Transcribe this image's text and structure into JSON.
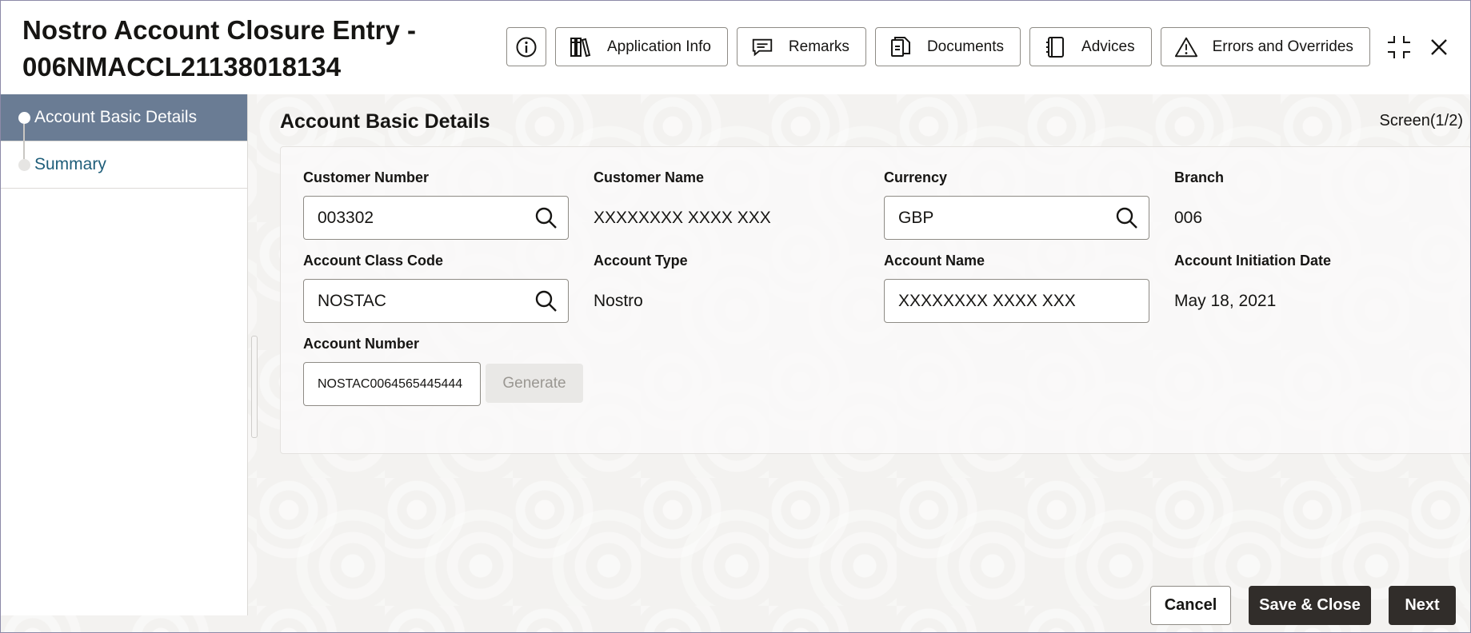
{
  "header": {
    "title_line1": "Nostro Account Closure Entry -",
    "title_line2": "006NMACCL21138018134",
    "toolbar": {
      "application_info": "Application Info",
      "remarks": "Remarks",
      "documents": "Documents",
      "advices": "Advices",
      "errors_overrides": "Errors and Overrides"
    }
  },
  "sidebar": {
    "items": [
      {
        "label": "Account Basic Details",
        "active": true
      },
      {
        "label": "Summary",
        "active": false
      }
    ]
  },
  "content": {
    "title": "Account Basic Details",
    "screen_indicator": "Screen(1/2)",
    "fields": {
      "customer_number": {
        "label": "Customer Number",
        "value": "003302"
      },
      "customer_name": {
        "label": "Customer Name",
        "value": "XXXXXXXX XXXX XXX"
      },
      "currency": {
        "label": "Currency",
        "value": "GBP"
      },
      "branch": {
        "label": "Branch",
        "value": "006"
      },
      "account_class_code": {
        "label": "Account Class Code",
        "value": "NOSTAC"
      },
      "account_type": {
        "label": "Account Type",
        "value": "Nostro"
      },
      "account_name": {
        "label": "Account Name",
        "value": "XXXXXXXX XXXX XXX"
      },
      "account_initiation_date": {
        "label": "Account Initiation Date",
        "value": "May 18, 2021"
      },
      "account_number": {
        "label": "Account Number",
        "value": "NOSTAC0064565445444"
      }
    },
    "generate_label": "Generate"
  },
  "footer": {
    "cancel": "Cancel",
    "save_close": "Save & Close",
    "next": "Next"
  },
  "colors": {
    "sidebar_active": "#6a7c94",
    "primary_button": "#312d2a",
    "link_text": "#1f5e7a"
  }
}
